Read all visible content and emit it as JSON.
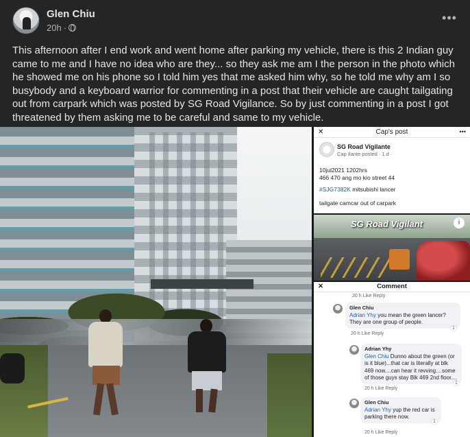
{
  "post": {
    "author": "Glen Chiu",
    "time": "20h",
    "dot": "·",
    "more": "•••",
    "text": "This afternoon after I end work and went home after parking my vehicle, there is this 2 Indian guy came to me and I have no idea who are they... so they ask me am I the person in the photo which he showed me on his phone so I told him yes that me asked him why, so he told me why am I so busybody and a keyboard warrior for commenting in a post that their vehicle are caught tailgating out from carpark which was posted by SG Road Vigilance. So by just commenting in a post I got threatened by them asking me to be careful and same to my vehicle."
  },
  "screenshot1": {
    "header": "Cap's post",
    "page_name": "SG Road Vigilante",
    "page_sub": "Cap Ilante posted · 1 d ·",
    "line1": "10jul2021 1202hrs",
    "line2": "466 470 ang mo kio street 44",
    "tag": "#SJG7382K",
    "line3_rest": " mitsubishi lancer",
    "line4": "tailgate camcar out of carpark"
  },
  "screenshot2": {
    "watermark": "SG Road Vigilant"
  },
  "screenshot3": {
    "header": "Comment",
    "ghost_row": "20 h   Like   Reply",
    "c1_name": "Glen Chiu",
    "c1_mention": "Adrian Yhy",
    "c1_text": " you mean the green lancer? They are one group of people.",
    "c1_acts": "20 h    Like    Reply",
    "c2_name": "Adrian Yhy",
    "c2_mention": "Glen Chiu",
    "c2_text": " Dunno about the green (or is it blue)...that car is literally at blk 469 now....can hear it revving....some of those guys stay Blk 469 2nd floor....",
    "c2_acts": "20 h    Like    Reply",
    "c3_name": "Glen Chiu",
    "c3_mention": "Adrian Yhy",
    "c3_text": " yup the red car is parking there now.",
    "c3_acts": "20 h    Like    Reply",
    "react1": "1",
    "react2": "1",
    "react3": "1"
  }
}
